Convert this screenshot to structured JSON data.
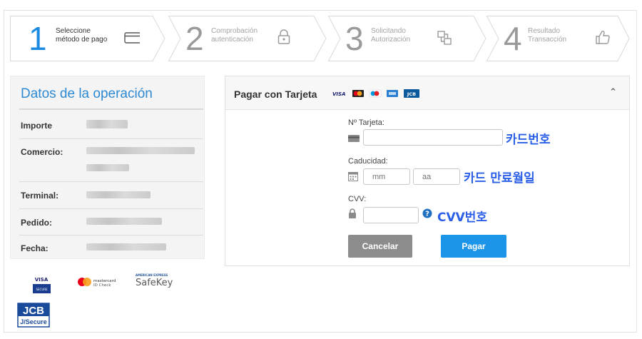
{
  "steps": [
    {
      "number": "1",
      "line1": "Seleccione",
      "line2": "método de pago",
      "icon": "card-icon",
      "state": "active"
    },
    {
      "number": "2",
      "line1": "Comprobación",
      "line2": "autenticación",
      "icon": "lock-icon",
      "state": "inactive"
    },
    {
      "number": "3",
      "line1": "Solicitando",
      "line2": "Autorización",
      "icon": "exchange-icon",
      "state": "inactive"
    },
    {
      "number": "4",
      "line1": "Resultado",
      "line2": "Transacción",
      "icon": "thumbs-up-icon",
      "state": "inactive"
    }
  ],
  "operation": {
    "title": "Datos de la operación",
    "rows": [
      {
        "label": "Importe"
      },
      {
        "label": "Comercio:"
      },
      {
        "label": "Terminal:"
      },
      {
        "label": "Pedido:"
      },
      {
        "label": "Fecha:"
      }
    ]
  },
  "payment": {
    "title": "Pagar con Tarjeta",
    "card_brands": [
      "VISA",
      "Mastercard",
      "Maestro",
      "Amex",
      "JCB"
    ],
    "card_number_label": "Nº Tarjeta:",
    "card_number_value": "",
    "expiry_label": "Caducidad:",
    "month_placeholder": "mm",
    "year_placeholder": "aa",
    "cvv_label": "CVV:",
    "cvv_value": "",
    "cancel_label": "Cancelar",
    "pay_label": "Pagar"
  },
  "annotations": {
    "card_number": "카드번호",
    "expiry": "카드 만료월일",
    "cvv": "CVV번호"
  },
  "logos": {
    "visa_top": "VISA",
    "visa_bottom": "SECURE",
    "mastercard_line1": "mastercard",
    "mastercard_line2": "ID Check",
    "amex_top": "AMERICAN EXPRESS",
    "amex_main": "SafeKey",
    "jcb_top": "JCB",
    "jcb_bottom": "J/Secure"
  },
  "colors": {
    "accent": "#1a8be0",
    "title_blue": "#2d8ad2",
    "annotation": "#2b5fe8",
    "cancel": "#8c8c8c",
    "pay": "#1c95e8"
  }
}
